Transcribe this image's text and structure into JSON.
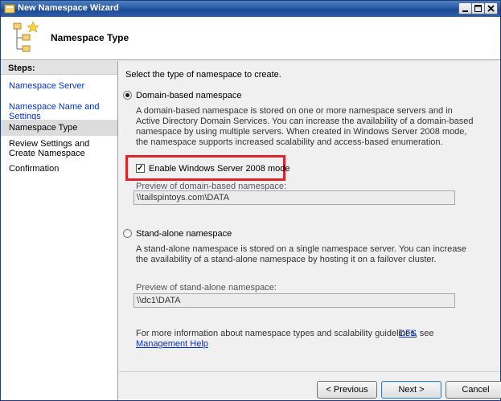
{
  "window": {
    "title": "New Namespace Wizard",
    "accent_color": "#2a5aa6",
    "icon": "wizard-icon"
  },
  "header": {
    "title": "Namespace Type",
    "icon": "namespace-tree-icon"
  },
  "steps": {
    "heading": "Steps:",
    "items": [
      {
        "label": "Namespace Server",
        "state": "link"
      },
      {
        "label": "Namespace Name and Settings",
        "state": "link"
      },
      {
        "label": "Namespace Type",
        "state": "current"
      },
      {
        "label": "Review Settings and Create Namespace",
        "state": "plain"
      },
      {
        "label": "Confirmation",
        "state": "plain"
      }
    ]
  },
  "main": {
    "instruction": "Select the type of namespace to create.",
    "domain": {
      "label": "Domain-based namespace",
      "selected": true,
      "description": "A domain-based namespace is stored on one or more namespace servers and in Active Directory Domain Services. You can increase the availability of a domain-based namespace by using multiple servers. When created in Windows Server 2008 mode, the namespace supports increased scalability and access-based enumeration.",
      "checkbox_label": "Enable Windows Server 2008 mode",
      "checkbox_checked": true,
      "highlight_color": "#e0232b",
      "preview_label": "Preview of domain-based namespace:",
      "preview_value": "\\\\tailspintoys.com\\DATA"
    },
    "standalone": {
      "label": "Stand-alone namespace",
      "selected": false,
      "description": "A stand-alone namespace is stored on a single namespace server. You can increase the availability of a stand-alone namespace by hosting it on a failover cluster.",
      "preview_label": "Preview of stand-alone namespace:",
      "preview_value": "\\\\dc1\\DATA"
    },
    "more_info_text": "For more information about namespace types and scalability guidelines, see ",
    "more_info_link_line1": "DFS",
    "more_info_link_line2": "Management Help",
    "more_info_suffix": "."
  },
  "buttons": {
    "previous": "< Previous",
    "next": "Next >",
    "cancel": "Cancel"
  }
}
